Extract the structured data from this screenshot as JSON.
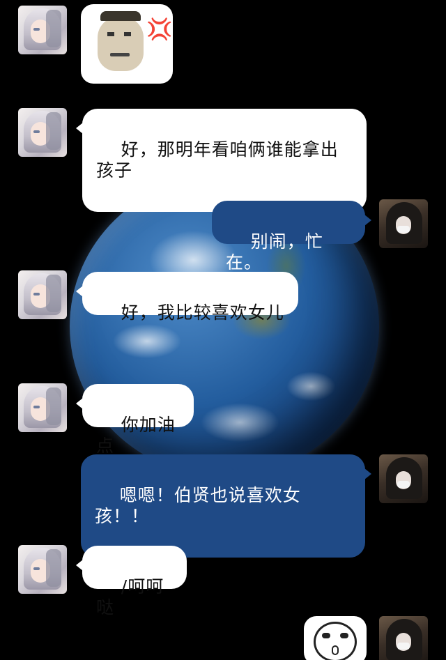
{
  "wallpaper": {
    "name": "earth-globe"
  },
  "messages": [
    {
      "id": "m1",
      "side": "left",
      "type": "sticker",
      "sticker": "angry-face-meme",
      "icon": "anger-vein-icon",
      "glyph": "💢"
    },
    {
      "id": "m2",
      "side": "left",
      "type": "text",
      "text": "好，那明年看咱俩谁能拿出孩子"
    },
    {
      "id": "m3",
      "side": "right",
      "type": "text",
      "text": "别闹，忙在。"
    },
    {
      "id": "m4",
      "side": "left",
      "type": "text",
      "text": "好，我比较喜欢女儿"
    },
    {
      "id": "m5",
      "side": "left",
      "type": "text",
      "text": "你加油点"
    },
    {
      "id": "m6",
      "side": "right",
      "type": "text",
      "text": "嗯嗯！伯贤也说喜欢女孩！！"
    },
    {
      "id": "m7",
      "side": "left",
      "type": "text",
      "text": "/呵呵哒"
    },
    {
      "id": "m8",
      "side": "right",
      "type": "sticker",
      "sticker": "cartoon-face-meme"
    }
  ],
  "colors": {
    "background": "#000000",
    "left_bubble": "#ffffff",
    "right_bubble": "#1f4a86"
  }
}
